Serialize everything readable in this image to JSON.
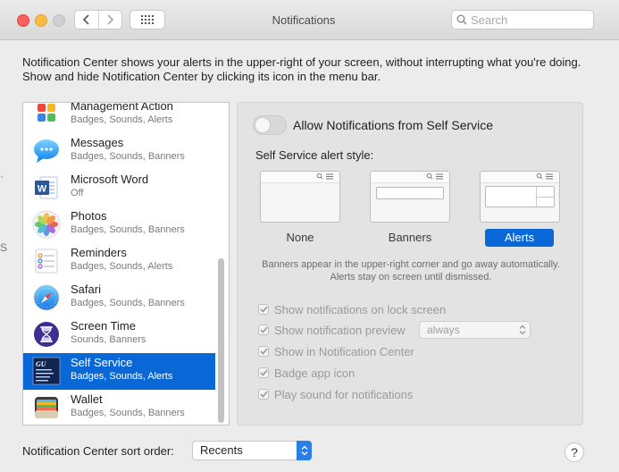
{
  "window": {
    "title": "Notifications"
  },
  "search": {
    "placeholder": "Search"
  },
  "description": "Notification Center shows your alerts in the upper-right of your screen, without interrupting what you're doing. Show and hide Notification Center by clicking its icon in the menu bar.",
  "apps": [
    {
      "name": "Management Action",
      "sub": "Badges, Sounds, Alerts",
      "icon": "management-action-icon"
    },
    {
      "name": "Messages",
      "sub": "Badges, Sounds, Banners",
      "icon": "messages-icon"
    },
    {
      "name": "Microsoft Word",
      "sub": "Off",
      "icon": "microsoft-word-icon"
    },
    {
      "name": "Photos",
      "sub": "Badges, Sounds, Banners",
      "icon": "photos-icon"
    },
    {
      "name": "Reminders",
      "sub": "Badges, Sounds, Alerts",
      "icon": "reminders-icon"
    },
    {
      "name": "Safari",
      "sub": "Badges, Sounds, Banners",
      "icon": "safari-icon"
    },
    {
      "name": "Screen Time",
      "sub": "Sounds, Banners",
      "icon": "screen-time-icon"
    },
    {
      "name": "Self Service",
      "sub": "Badges, Sounds, Alerts",
      "icon": "self-service-icon",
      "selected": true
    },
    {
      "name": "Wallet",
      "sub": "Badges, Sounds, Banners",
      "icon": "wallet-icon"
    }
  ],
  "detail": {
    "allow_label": "Allow Notifications from Self Service",
    "allow_enabled": false,
    "style_label": "Self Service alert style:",
    "styles": {
      "none": "None",
      "banners": "Banners",
      "alerts": "Alerts"
    },
    "selected_style": "Alerts",
    "style_description": "Banners appear in the upper-right corner and go away automatically. Alerts stay on screen until dismissed.",
    "options": {
      "lock_screen": "Show notifications on lock screen",
      "preview": "Show notification preview",
      "preview_value": "always",
      "notification_center": "Show in Notification Center",
      "badge": "Badge app icon",
      "sound": "Play sound for notifications"
    }
  },
  "sort": {
    "label": "Notification Center sort order:",
    "value": "Recents"
  },
  "help_label": "?",
  "edge_glyph": "S",
  "colors": {
    "accent": "#0a68d6",
    "window_bg": "#ececec"
  }
}
